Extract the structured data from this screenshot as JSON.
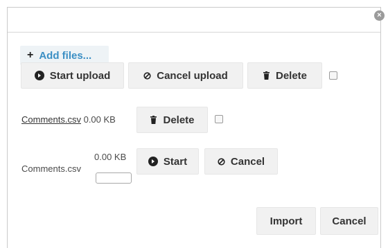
{
  "dialog": {
    "close_label": "×"
  },
  "toolbar": {
    "add_files_label": "Add files...",
    "start_upload_label": "Start upload",
    "cancel_upload_label": "Cancel upload",
    "delete_label": "Delete"
  },
  "uploaded_file": {
    "name": "Comments.csv",
    "size": "0.00 KB",
    "delete_label": "Delete"
  },
  "pending_file": {
    "name": "Comments.csv",
    "size": "0.00 KB",
    "start_label": "Start",
    "cancel_label": "Cancel",
    "progress": 0
  },
  "footer": {
    "import_label": "Import",
    "cancel_label": "Cancel"
  },
  "icons": {
    "add": "plus-icon",
    "start": "circle-arrow-icon",
    "cancel": "ban-icon",
    "delete": "trash-icon",
    "close": "close-icon"
  },
  "colors": {
    "link": "#3b8fc4",
    "button_bg": "#f1f1f1",
    "border": "#c9c9c9"
  }
}
